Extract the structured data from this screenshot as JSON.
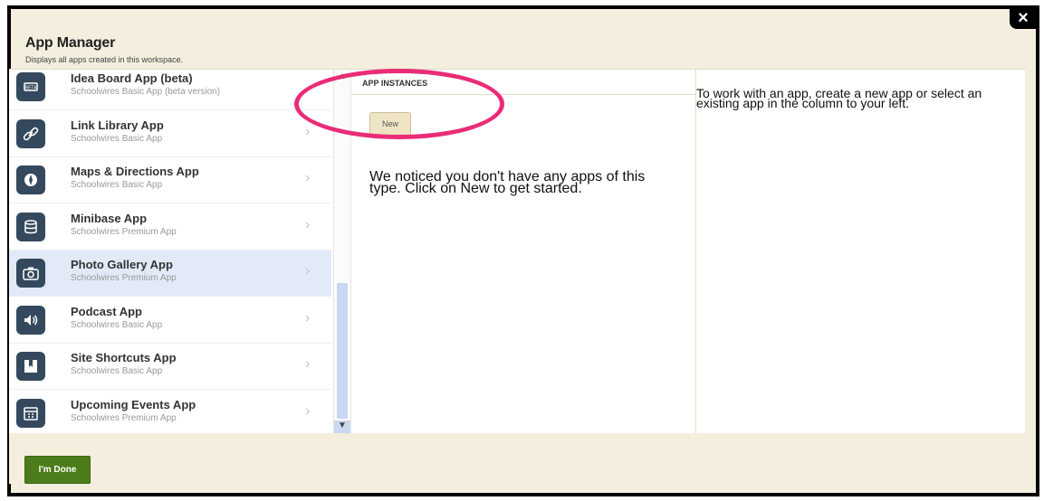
{
  "dialog": {
    "title": "App Manager",
    "subtitle": "Displays all apps created in this workspace.",
    "close_label": "×"
  },
  "apps": [
    {
      "name": "Idea Board App (beta)",
      "sub": "Schoolwires Basic App (beta version)",
      "icon": "beta-icon",
      "selected": false
    },
    {
      "name": "Link Library App",
      "sub": "Schoolwires Basic App",
      "icon": "link-icon",
      "selected": false
    },
    {
      "name": "Maps & Directions App",
      "sub": "Schoolwires Basic App",
      "icon": "compass-icon",
      "selected": false
    },
    {
      "name": "Minibase App",
      "sub": "Schoolwires Premium App",
      "icon": "database-icon",
      "selected": false
    },
    {
      "name": "Photo Gallery App",
      "sub": "Schoolwires Premium App",
      "icon": "camera-icon",
      "selected": true
    },
    {
      "name": "Podcast App",
      "sub": "Schoolwires Basic App",
      "icon": "speaker-icon",
      "selected": false
    },
    {
      "name": "Site Shortcuts App",
      "sub": "Schoolwires Basic App",
      "icon": "bookmark-icon",
      "selected": false
    },
    {
      "name": "Upcoming Events App",
      "sub": "Schoolwires Premium App",
      "icon": "calendar-icon",
      "selected": false
    }
  ],
  "instances": {
    "header": "APP INSTANCES",
    "new_label": "New",
    "empty_message": "We noticed you don't have any apps of this type. Click on New to get started."
  },
  "info": {
    "text": "To work with an app, create a new app or select an existing app in the column to your left."
  },
  "footer": {
    "done_label": "I'm Done"
  },
  "colors": {
    "annotation_ring": "#ea2c78",
    "done_button": "#4d7d1a",
    "selected_row": "#e2eaf8"
  }
}
